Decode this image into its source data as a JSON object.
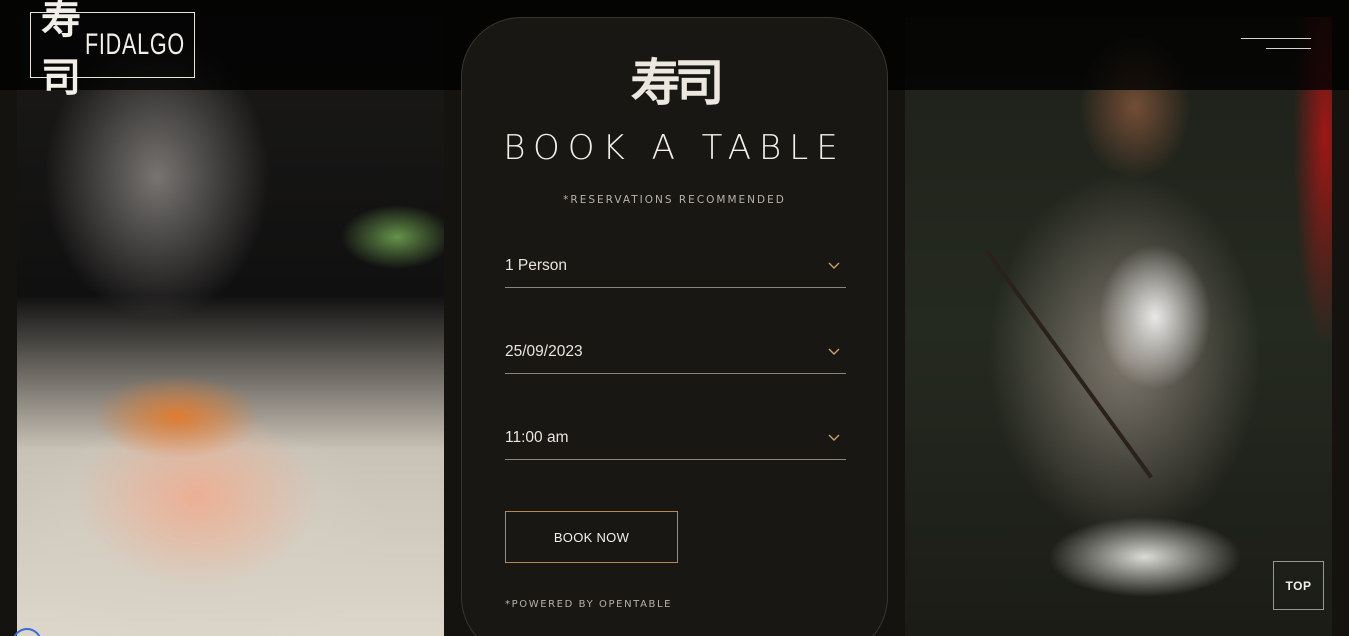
{
  "header": {
    "logo_kanji": "寿司",
    "logo_text": "FIDALGO",
    "menu_icon": "hamburger-icon"
  },
  "booking": {
    "kanji": "寿司",
    "title": "BOOK A TABLE",
    "subtitle": "*RESERVATIONS RECOMMENDED",
    "party_size": "1 Person",
    "date": "25/09/2023",
    "time": "11:00 am",
    "book_label": "BOOK NOW",
    "powered_by": "*POWERED BY OPENTABLE"
  },
  "top_button": {
    "label": "TOP"
  },
  "colors": {
    "background": "#141310",
    "card": "#181714",
    "accent_border": "#b58a52",
    "text": "#f2efe9"
  }
}
